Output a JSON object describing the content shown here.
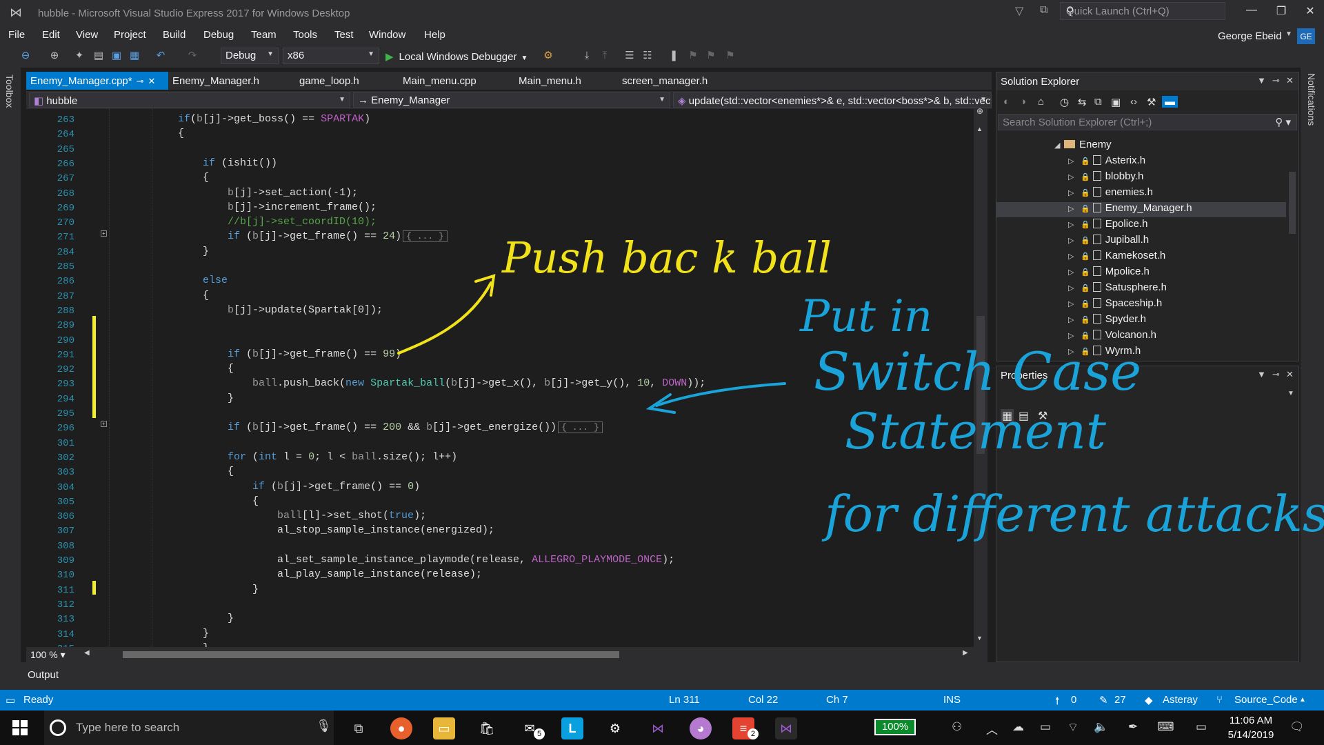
{
  "window": {
    "title": "hubble - Microsoft Visual Studio Express 2017 for Windows Desktop",
    "quick_launch_placeholder": "Quick Launch (Ctrl+Q)"
  },
  "menu": [
    "File",
    "Edit",
    "View",
    "Project",
    "Build",
    "Debug",
    "Team",
    "Tools",
    "Test",
    "Window",
    "Help"
  ],
  "user": {
    "name": "George Ebeid",
    "initials": "GE"
  },
  "toolbar": {
    "config": "Debug",
    "platform": "x86",
    "debugger": "Local Windows Debugger"
  },
  "side": {
    "toolbox": "Toolbox",
    "notifications": "Notifications"
  },
  "tabs": [
    "Enemy_Manager.cpp*",
    "Enemy_Manager.h",
    "game_loop.h",
    "Main_menu.cpp",
    "Main_menu.h",
    "screen_manager.h"
  ],
  "nav": {
    "project": "hubble",
    "scope": "Enemy_Manager",
    "member": "update(std::vector<enemies*>& e, std::vector<boss*>& b, std::vector"
  },
  "code": {
    "line_numbers": [
      "263",
      "264",
      "265",
      "266",
      "267",
      "268",
      "269",
      "270",
      "271",
      "284",
      "285",
      "286",
      "287",
      "288",
      "289",
      "290",
      "291",
      "292",
      "293",
      "294",
      "295",
      "296",
      "301",
      "302",
      "303",
      "304",
      "305",
      "306",
      "307",
      "308",
      "309",
      "310",
      "311",
      "312",
      "313",
      "314",
      "315"
    ]
  },
  "zoom": "100 %",
  "output_label": "Output",
  "solution_explorer": {
    "title": "Solution Explorer",
    "search_placeholder": "Search Solution Explorer (Ctrl+;)",
    "folder": "Enemy",
    "files": [
      "Asterix.h",
      "blobby.h",
      "enemies.h",
      "Enemy_Manager.h",
      "Epolice.h",
      "Jupiball.h",
      "Kamekoset.h",
      "Mpolice.h",
      "Satusphere.h",
      "Spaceship.h",
      "Spyder.h",
      "Volcanon.h",
      "Wyrm.h"
    ],
    "selected": "Enemy_Manager.h"
  },
  "properties": {
    "title": "Properties"
  },
  "status": {
    "state": "Ready",
    "ln": "Ln 311",
    "col": "Col 22",
    "ch": "Ch 7",
    "mode": "INS",
    "up": "0",
    "edits": "27",
    "repo": "Asteray",
    "branch": "Source_Code"
  },
  "taskbar": {
    "search_placeholder": "Type here to search",
    "battery": "100%",
    "time": "11:06 AM",
    "date": "5/14/2019",
    "badge_mail": "5",
    "badge_todo": "2"
  },
  "annotations": {
    "yellow": "Push bac k ball",
    "blue_line1": "Put in",
    "blue_line2": "Switch Case",
    "blue_line3": "Statement",
    "blue_line4": "for different attacks"
  },
  "colors": {
    "accent": "#007acc",
    "ink_yellow": "#f2e21a",
    "ink_blue": "#1aa3d8",
    "change_bar": "#efef2f"
  }
}
